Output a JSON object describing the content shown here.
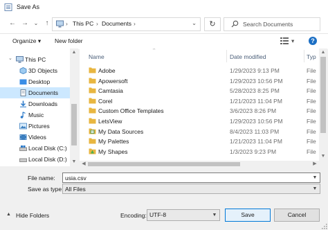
{
  "window": {
    "title": "Save As"
  },
  "address": {
    "back_glyph": "←",
    "forward_glyph": "→",
    "recent_glyph": "⌄",
    "up_glyph": "↑",
    "crumbs": [
      "This PC",
      "Documents"
    ],
    "separator": "›",
    "dropdown_glyph": "⌄",
    "refresh_glyph": "↻",
    "search_placeholder": "Search Documents"
  },
  "toolbar": {
    "organize_label": "Organize ▾",
    "new_folder_label": "New folder",
    "view_dropdown_glyph": "▾",
    "help_glyph": "?"
  },
  "nav": {
    "items": [
      {
        "label": "This PC",
        "icon": "pc-icon",
        "expand": "⌄",
        "selected": false
      },
      {
        "label": "3D Objects",
        "icon": "cube-icon",
        "expand": "",
        "selected": false
      },
      {
        "label": "Desktop",
        "icon": "folder-icon",
        "expand": "",
        "selected": false
      },
      {
        "label": "Documents",
        "icon": "document-icon",
        "expand": "",
        "selected": true
      },
      {
        "label": "Downloads",
        "icon": "download-icon",
        "expand": "",
        "selected": false
      },
      {
        "label": "Music",
        "icon": "music-icon",
        "expand": "",
        "selected": false
      },
      {
        "label": "Pictures",
        "icon": "picture-icon",
        "expand": "",
        "selected": false
      },
      {
        "label": "Videos",
        "icon": "video-icon",
        "expand": "",
        "selected": false
      },
      {
        "label": "Local Disk (C:)",
        "icon": "drive-icon",
        "expand": "",
        "selected": false
      },
      {
        "label": "Local Disk (D:)",
        "icon": "drive-icon",
        "expand": "",
        "selected": false
      }
    ]
  },
  "files": {
    "columns": {
      "name": "Name",
      "date": "Date modified",
      "type": "Typ",
      "sort_glyph": "^"
    },
    "rows": [
      {
        "name": "Adobe",
        "date": "1/29/2023 9:13 PM",
        "type": "File",
        "icon": "folder-icon"
      },
      {
        "name": "Apowersoft",
        "date": "1/29/2023 10:56 PM",
        "type": "File",
        "icon": "folder-icon"
      },
      {
        "name": "Camtasia",
        "date": "5/28/2023 8:25 PM",
        "type": "File",
        "icon": "folder-icon"
      },
      {
        "name": "Corel",
        "date": "1/21/2023 11:04 PM",
        "type": "File",
        "icon": "folder-icon"
      },
      {
        "name": "Custom Office Templates",
        "date": "3/6/2023 8:26 PM",
        "type": "File",
        "icon": "folder-icon"
      },
      {
        "name": "LetsView",
        "date": "1/29/2023 10:56 PM",
        "type": "File",
        "icon": "folder-icon"
      },
      {
        "name": "My Data Sources",
        "date": "8/4/2023 11:03 PM",
        "type": "File",
        "icon": "datasource-folder-icon"
      },
      {
        "name": "My Palettes",
        "date": "1/21/2023 11:04 PM",
        "type": "File",
        "icon": "folder-icon"
      },
      {
        "name": "My Shapes",
        "date": "1/3/2023 9:23 PM",
        "type": "File",
        "icon": "shapes-folder-icon"
      }
    ]
  },
  "form": {
    "filename_label": "File name:",
    "filename_value": "usia.csv",
    "savetype_label": "Save as type:",
    "savetype_value": "All Files",
    "hide_folders_label": "Hide Folders",
    "encoding_label": "Encoding:",
    "encoding_value": "UTF-8",
    "save_label": "Save",
    "cancel_label": "Cancel"
  },
  "colors": {
    "accent": "#0078d7",
    "selection": "#cce8ff",
    "folder": "#e8b640"
  }
}
